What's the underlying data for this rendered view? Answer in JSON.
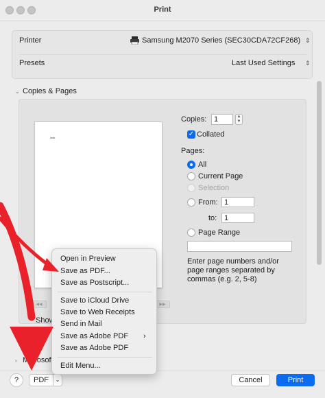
{
  "window": {
    "title": "Print"
  },
  "printer": {
    "label": "Printer",
    "value": "Samsung M2070 Series (SEC30CDA72CF268)"
  },
  "presets": {
    "label": "Presets",
    "value": "Last Used Settings"
  },
  "section": {
    "title": "Copies & Pages"
  },
  "copies": {
    "label": "Copies:",
    "value": "1"
  },
  "collated": {
    "label": "Collated",
    "checked": true
  },
  "pages": {
    "label": "Pages:",
    "all": "All",
    "current": "Current Page",
    "selection": "Selection",
    "from_label": "From:",
    "from_value": "1",
    "to_label": "to:",
    "to_value": "1",
    "range": "Page Range",
    "range_value": "",
    "hint": [
      "Enter page numbers and/or",
      "page ranges separated by",
      "commas (e.g. 2, 5-8)"
    ]
  },
  "preview": {
    "text": "look"
  },
  "partial": {
    "show": "Show",
    "microsoft": "Microsof"
  },
  "menu": {
    "items": [
      "Open in Preview",
      "Save as PDF...",
      "Save as Postscript...",
      "Save to iCloud Drive",
      "Save to Web Receipts",
      "Send in Mail",
      "Save as Adobe PDF",
      "Save as Adobe PDF",
      "Edit Menu..."
    ]
  },
  "bottom": {
    "help": "?",
    "pdf": "PDF",
    "cancel": "Cancel",
    "print": "Print"
  },
  "colors": {
    "accent": "#0b6cf0",
    "arrow": "#e8212a"
  },
  "icons": {
    "printer": "printer-icon",
    "updown": "chevron-updown-icon",
    "submenu": "chevron-right-icon",
    "dropdown": "chevron-down-icon"
  }
}
